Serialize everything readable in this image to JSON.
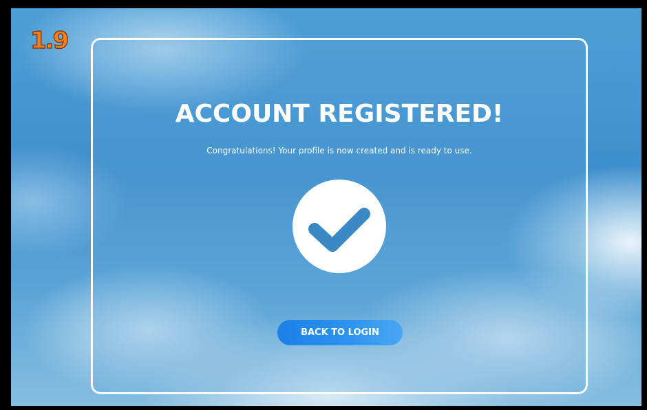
{
  "version_badge": "1.9",
  "dialog": {
    "title": "ACCOUNT REGISTERED!",
    "message": "Congratulations! Your profile is now created and is ready to use.",
    "icon": "checkmark-circle-icon",
    "back_button_label": "BACK TO LOGIN"
  },
  "colors": {
    "accent": "#2f95f0",
    "check": "#3a88c4",
    "badge": "#f2821e"
  }
}
